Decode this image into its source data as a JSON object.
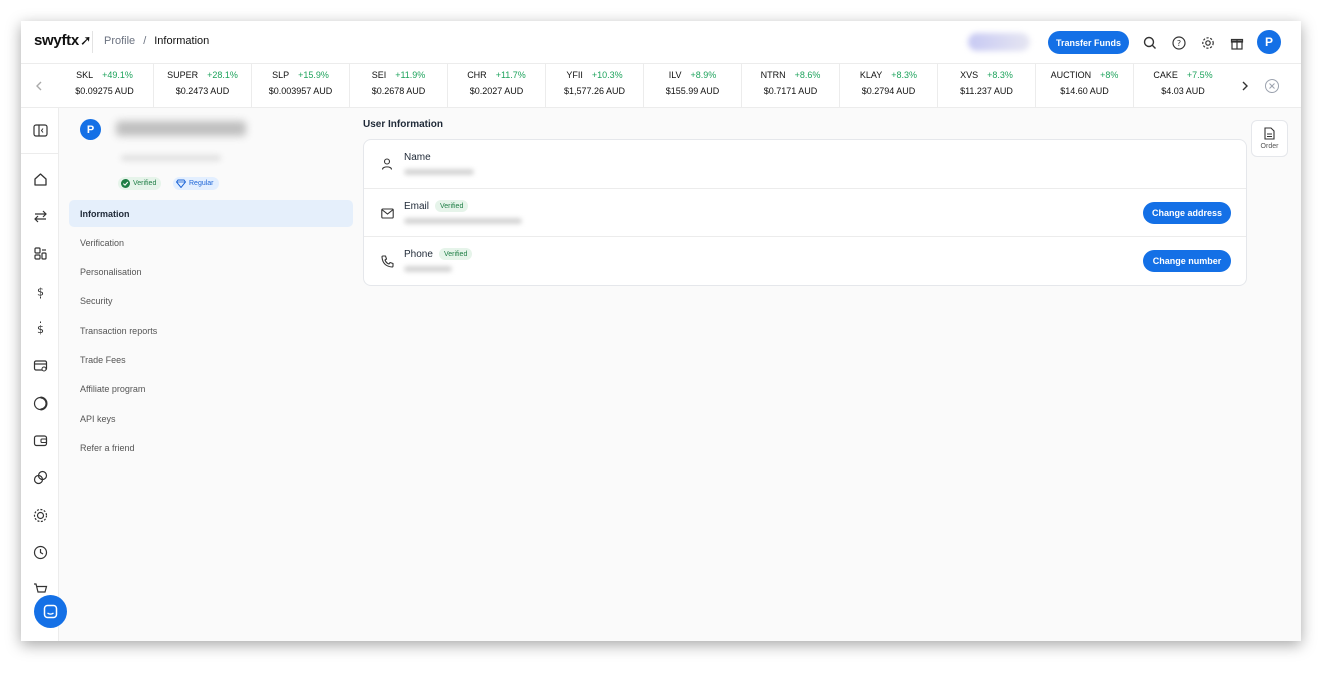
{
  "header": {
    "logo": "swyftx",
    "breadcrumb": [
      "Profile",
      "Information"
    ],
    "transfer_button": "Transfer Funds",
    "avatar_initial": "P"
  },
  "ticker": [
    {
      "symbol": "SKL",
      "change": "+49.1%",
      "price": "$0.09275 AUD"
    },
    {
      "symbol": "SUPER",
      "change": "+28.1%",
      "price": "$0.2473 AUD"
    },
    {
      "symbol": "SLP",
      "change": "+15.9%",
      "price": "$0.003957 AUD"
    },
    {
      "symbol": "SEI",
      "change": "+11.9%",
      "price": "$0.2678 AUD"
    },
    {
      "symbol": "CHR",
      "change": "+11.7%",
      "price": "$0.2027 AUD"
    },
    {
      "symbol": "YFII",
      "change": "+10.3%",
      "price": "$1,577.26 AUD"
    },
    {
      "symbol": "ILV",
      "change": "+8.9%",
      "price": "$155.99 AUD"
    },
    {
      "symbol": "NTRN",
      "change": "+8.6%",
      "price": "$0.7171 AUD"
    },
    {
      "symbol": "KLAY",
      "change": "+8.3%",
      "price": "$0.2794 AUD"
    },
    {
      "symbol": "XVS",
      "change": "+8.3%",
      "price": "$11.237 AUD"
    },
    {
      "symbol": "AUCTION",
      "change": "+8%",
      "price": "$14.60 AUD"
    },
    {
      "symbol": "CAKE",
      "change": "+7.5%",
      "price": "$4.03 AUD"
    }
  ],
  "profile": {
    "avatar_initial": "P",
    "badges": [
      "Verified",
      "Regular"
    ]
  },
  "menu": [
    "Information",
    "Verification",
    "Personalisation",
    "Security",
    "Transaction reports",
    "Trade Fees",
    "Affiliate program",
    "API keys",
    "Refer a friend"
  ],
  "main": {
    "title": "User Information",
    "rows": [
      {
        "label": "Name",
        "badge": "",
        "button": ""
      },
      {
        "label": "Email",
        "badge": "Verified",
        "button": "Change address"
      },
      {
        "label": "Phone",
        "badge": "Verified",
        "button": "Change number"
      }
    ]
  },
  "order_button": "Order",
  "colors": {
    "accent": "#1470e6",
    "positive": "#1ea35c",
    "verified_bg": "#e6f4ea"
  }
}
